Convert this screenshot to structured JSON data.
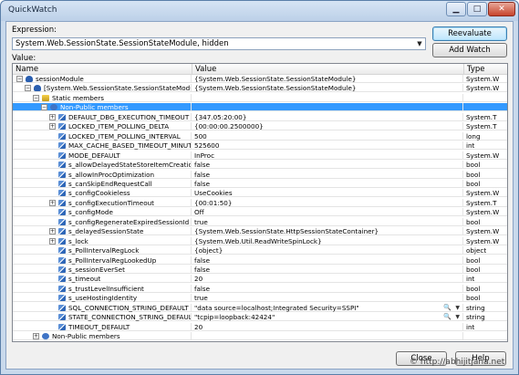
{
  "window": {
    "title": "QuickWatch"
  },
  "expression": {
    "label": "Expression:",
    "value": "System.Web.SessionState.SessionStateModule, hidden"
  },
  "buttons": {
    "reevaluate": "Reevaluate",
    "add_watch": "Add Watch",
    "close": "Close",
    "help": "Help"
  },
  "value_label": "Value:",
  "columns": {
    "name": "Name",
    "value": "Value",
    "type": "Type"
  },
  "rows": [
    {
      "name": "sessionModule",
      "value": "{System.Web.SessionState.SessionStateModule}",
      "type": "System.W",
      "depth": 0,
      "expander": "minus",
      "icon": "object",
      "selected": false,
      "magnifier": false
    },
    {
      "name": "[System.Web.SessionState.SessionStateModule]",
      "value": "{System.Web.SessionState.SessionStateModule}",
      "type": "System.W",
      "depth": 1,
      "expander": "minus",
      "icon": "object",
      "selected": false,
      "magnifier": false
    },
    {
      "name": "Static members",
      "value": "",
      "type": "",
      "depth": 2,
      "expander": "minus",
      "icon": "static",
      "selected": false,
      "magnifier": false
    },
    {
      "name": "Non-Public members",
      "value": "",
      "type": "",
      "depth": 3,
      "expander": "minus",
      "icon": "nonpublic",
      "selected": true,
      "magnifier": false
    },
    {
      "name": "DEFAULT_DBG_EXECUTION_TIMEOUT",
      "value": "{347.05:20:00}",
      "type": "System.T",
      "depth": 4,
      "expander": "plus",
      "icon": "property",
      "selected": false,
      "magnifier": false
    },
    {
      "name": "LOCKED_ITEM_POLLING_DELTA",
      "value": "{00:00:00.2500000}",
      "type": "System.T",
      "depth": 4,
      "expander": "plus",
      "icon": "property",
      "selected": false,
      "magnifier": false
    },
    {
      "name": "LOCKED_ITEM_POLLING_INTERVAL",
      "value": "500",
      "type": "long",
      "depth": 4,
      "expander": "none",
      "icon": "property",
      "selected": false,
      "magnifier": false
    },
    {
      "name": "MAX_CACHE_BASED_TIMEOUT_MINUTE",
      "value": "525600",
      "type": "int",
      "depth": 4,
      "expander": "none",
      "icon": "property",
      "selected": false,
      "magnifier": false
    },
    {
      "name": "MODE_DEFAULT",
      "value": "InProc",
      "type": "System.W",
      "depth": 4,
      "expander": "none",
      "icon": "property",
      "selected": false,
      "magnifier": false
    },
    {
      "name": "s_allowDelayedStateStoreItemCreation",
      "value": "false",
      "type": "bool",
      "depth": 4,
      "expander": "none",
      "icon": "property",
      "selected": false,
      "magnifier": false
    },
    {
      "name": "s_allowInProcOptimization",
      "value": "false",
      "type": "bool",
      "depth": 4,
      "expander": "none",
      "icon": "property",
      "selected": false,
      "magnifier": false
    },
    {
      "name": "s_canSkipEndRequestCall",
      "value": "false",
      "type": "bool",
      "depth": 4,
      "expander": "none",
      "icon": "property",
      "selected": false,
      "magnifier": false
    },
    {
      "name": "s_configCookieless",
      "value": "UseCookies",
      "type": "System.W",
      "depth": 4,
      "expander": "none",
      "icon": "property",
      "selected": false,
      "magnifier": false
    },
    {
      "name": "s_configExecutionTimeout",
      "value": "{00:01:50}",
      "type": "System.T",
      "depth": 4,
      "expander": "plus",
      "icon": "property",
      "selected": false,
      "magnifier": false
    },
    {
      "name": "s_configMode",
      "value": "Off",
      "type": "System.W",
      "depth": 4,
      "expander": "none",
      "icon": "property",
      "selected": false,
      "magnifier": false
    },
    {
      "name": "s_configRegenerateExpiredSessionId",
      "value": "true",
      "type": "bool",
      "depth": 4,
      "expander": "none",
      "icon": "property",
      "selected": false,
      "magnifier": false
    },
    {
      "name": "s_delayedSessionState",
      "value": "{System.Web.SessionState.HttpSessionStateContainer}",
      "type": "System.W",
      "depth": 4,
      "expander": "plus",
      "icon": "property",
      "selected": false,
      "magnifier": false
    },
    {
      "name": "s_lock",
      "value": "{System.Web.Util.ReadWriteSpinLock}",
      "type": "System.W",
      "depth": 4,
      "expander": "plus",
      "icon": "property",
      "selected": false,
      "magnifier": false
    },
    {
      "name": "s_PollIntervalRegLock",
      "value": "{object}",
      "type": "object",
      "depth": 4,
      "expander": "none",
      "icon": "property",
      "selected": false,
      "magnifier": false
    },
    {
      "name": "s_PollIntervalRegLookedUp",
      "value": "false",
      "type": "bool",
      "depth": 4,
      "expander": "none",
      "icon": "property",
      "selected": false,
      "magnifier": false
    },
    {
      "name": "s_sessionEverSet",
      "value": "false",
      "type": "bool",
      "depth": 4,
      "expander": "none",
      "icon": "property",
      "selected": false,
      "magnifier": false
    },
    {
      "name": "s_timeout",
      "value": "20",
      "type": "int",
      "depth": 4,
      "expander": "none",
      "icon": "property",
      "selected": false,
      "magnifier": false
    },
    {
      "name": "s_trustLevelInsufficient",
      "value": "false",
      "type": "bool",
      "depth": 4,
      "expander": "none",
      "icon": "property",
      "selected": false,
      "magnifier": false
    },
    {
      "name": "s_useHostingIdentity",
      "value": "true",
      "type": "bool",
      "depth": 4,
      "expander": "none",
      "icon": "property",
      "selected": false,
      "magnifier": false
    },
    {
      "name": "SQL_CONNECTION_STRING_DEFAULT",
      "value": "\"data source=localhost;Integrated Security=SSPI\"",
      "type": "string",
      "depth": 4,
      "expander": "none",
      "icon": "property",
      "selected": false,
      "magnifier": true
    },
    {
      "name": "STATE_CONNECTION_STRING_DEFAULT",
      "value": "\"tcpip=loopback:42424\"",
      "type": "string",
      "depth": 4,
      "expander": "none",
      "icon": "property",
      "selected": false,
      "magnifier": true
    },
    {
      "name": "TIMEOUT_DEFAULT",
      "value": "20",
      "type": "int",
      "depth": 4,
      "expander": "none",
      "icon": "property",
      "selected": false,
      "magnifier": false
    },
    {
      "name": "Non-Public members",
      "value": "",
      "type": "",
      "depth": 2,
      "expander": "plus",
      "icon": "nonpublic",
      "selected": false,
      "magnifier": false
    }
  ],
  "watermark": "© http://abhijitjana.net",
  "colors": {
    "selection": "#3399ff",
    "titlebar": "#c9d9ec",
    "close_button": "#c7432b"
  }
}
